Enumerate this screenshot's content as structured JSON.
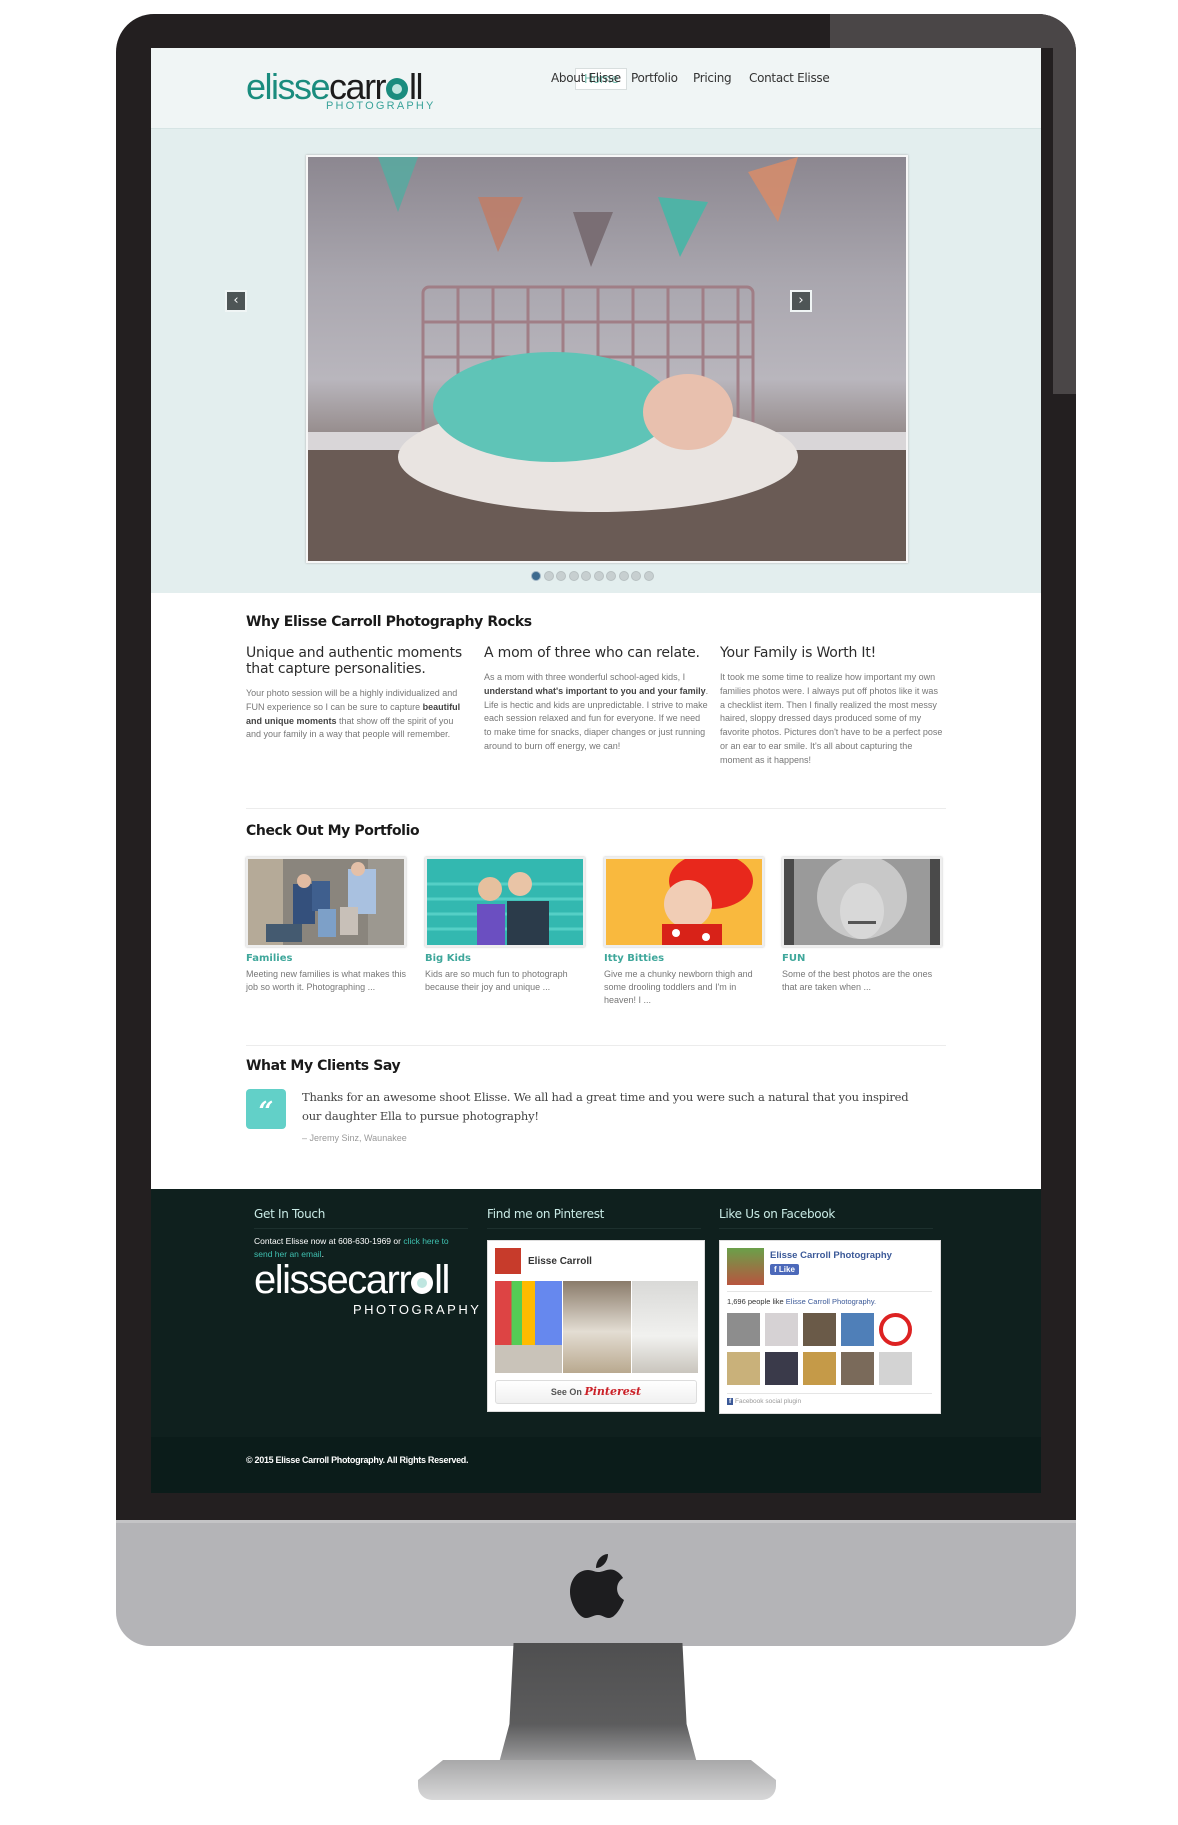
{
  "header": {
    "logo": {
      "part1": "elisse",
      "part2": "carr",
      "part3": "ll",
      "subtitle": "PHOTOGRAPHY"
    },
    "nav": [
      {
        "label": "Home",
        "active": true
      },
      {
        "label": "About Elisse",
        "active": false
      },
      {
        "label": "Portfolio",
        "active": false
      },
      {
        "label": "Pricing",
        "active": false
      },
      {
        "label": "Contact Elisse",
        "active": false
      }
    ]
  },
  "slider": {
    "prev_icon": "‹",
    "next_icon": "›",
    "slide_description": "Newborn sleeping in wire basket with teal blanket under pennant bunting",
    "dots_total": 10,
    "active_dot": 1
  },
  "why": {
    "heading": "Why Elisse Carroll Photography Rocks",
    "columns": [
      {
        "title": "Unique and authentic moments that capture personalities.",
        "text_pre": "Your photo session will be a highly individualized and FUN experience so I can be sure to capture ",
        "text_bold": "beautiful and unique moments",
        "text_post": " that show off the spirit of you and your family in a way that people will remember."
      },
      {
        "title": "A mom of three who can relate.",
        "text_pre": "As a mom with three wonderful school-aged kids, I ",
        "text_bold": "understand what's important to you and your family",
        "text_post": ". Life is hectic and kids are unpredictable. I strive to make each session relaxed and fun for everyone. If we need to make time for snacks, diaper changes or just running around to burn off energy, we can!"
      },
      {
        "title": "Your Family is Worth It!",
        "text_pre": "It took me some time to realize how important my own families photos were. I always put off photos like it was a checklist item. Then I finally realized the most messy haired, sloppy dressed days produced some of my favorite photos. Pictures don't have to be a perfect pose or an ear to ear smile. It's all about capturing the moment as it happens!",
        "text_bold": "",
        "text_post": ""
      }
    ]
  },
  "portfolio": {
    "heading": "Check Out My Portfolio",
    "items": [
      {
        "title": "Families",
        "text": "Meeting new families is what makes this job so worth it.  Photographing ...",
        "image": "family seated on porch steps"
      },
      {
        "title": "Big Kids",
        "text": "Kids are so much fun to photograph because their joy and unique ...",
        "image": "two girls in front of teal steps"
      },
      {
        "title": "Itty Bitties",
        "text": "Give me a chunky newborn thigh and some drooling toddlers and I'm in heaven!  I ...",
        "image": "toddler with red feather hat on yellow"
      },
      {
        "title": "FUN",
        "text": "Some of the best photos are the ones that are taken when ...",
        "image": "black and white girl with fur hat"
      }
    ]
  },
  "clients": {
    "heading": "What My Clients Say",
    "quote_icon": "“",
    "quote": "Thanks for an awesome shoot Elisse. We all had a great time and you were such a natural that you inspired our daughter Ella to pursue photography!",
    "author": "– Jeremy Sinz, Waunakee"
  },
  "footer": {
    "get_in_touch": {
      "heading": "Get In Touch",
      "text": "Contact Elisse now at 608-630-1969 or ",
      "link": "click here to send her an email",
      "after": ".",
      "logo": {
        "part1": "elissecarr",
        "part2": "ll",
        "subtitle": "PHOTOGRAPHY"
      }
    },
    "pinterest": {
      "heading": "Find me on Pinterest",
      "profile_name": "Elisse Carroll",
      "button_prefix": "See On",
      "button_brand": "Pinterest"
    },
    "facebook": {
      "heading": "Like Us on Facebook",
      "page_name": "Elisse Carroll Photography",
      "like_label": "Like",
      "count_prefix": "1,696 people like ",
      "count_page": "Elisse Carroll Photography.",
      "plugin_label": "Facebook social plugin"
    },
    "copyright": "© 2015 Elisse Carroll Photography. All Rights Reserved."
  },
  "colors": {
    "accent": "#1a8c7e",
    "teal_light": "#62d0c8",
    "footer_bg": "#0f201e",
    "header_bg": "#f0f5f5",
    "slider_bg": "#e3eeee"
  }
}
